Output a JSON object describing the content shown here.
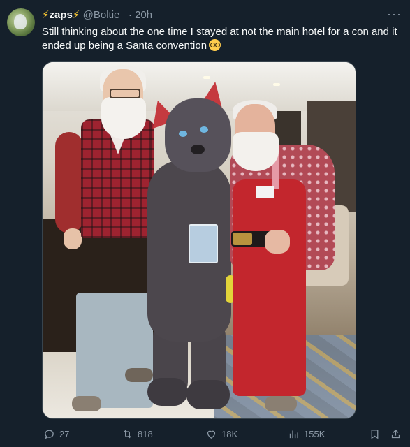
{
  "tweet": {
    "author": {
      "bolt_left": "⚡",
      "display_name": "zaps",
      "bolt_right": "⚡",
      "handle": "@Boltie_",
      "separator": "·",
      "time": "20h"
    },
    "more_label": "···",
    "text": "Still thinking about the one time I stayed at not the main hotel for a con and it ended up being a Santa convention",
    "emoji_icon": "nerd-face-emoji"
  },
  "actions": {
    "replies": "27",
    "retweets": "818",
    "likes": "18K",
    "views": "155K"
  },
  "colors": {
    "background": "#15202b",
    "text_primary": "#f7f9f9",
    "text_secondary": "#8b98a5",
    "bolt": "#ffcc33"
  }
}
